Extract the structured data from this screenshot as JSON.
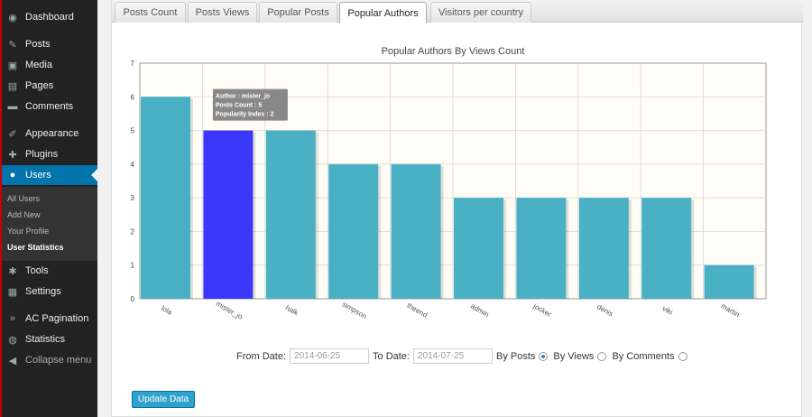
{
  "sidebar": {
    "items": [
      {
        "label": "Dashboard",
        "icon": "dashboard-icon"
      },
      {
        "label": "Posts",
        "icon": "pin-icon"
      },
      {
        "label": "Media",
        "icon": "media-icon"
      },
      {
        "label": "Pages",
        "icon": "pages-icon"
      },
      {
        "label": "Comments",
        "icon": "comment-icon"
      },
      {
        "label": "Appearance",
        "icon": "brush-icon"
      },
      {
        "label": "Plugins",
        "icon": "plugin-icon"
      },
      {
        "label": "Users",
        "icon": "user-icon"
      },
      {
        "label": "Tools",
        "icon": "wrench-icon"
      },
      {
        "label": "Settings",
        "icon": "settings-icon"
      },
      {
        "label": "AC Pagination",
        "icon": "chevrons-icon"
      },
      {
        "label": "Statistics",
        "icon": "globe-icon"
      },
      {
        "label": "Collapse menu",
        "icon": "collapse-icon"
      }
    ],
    "submenu": [
      "All Users",
      "Add New",
      "Your Profile",
      "User Statistics"
    ],
    "colors": {
      "background": "#222222",
      "active": "#0073aa"
    }
  },
  "tabs": [
    "Posts Count",
    "Posts Views",
    "Popular Posts",
    "Popular Authors",
    "Visitors per country"
  ],
  "chart_data": {
    "type": "bar",
    "title": "Popular Authors By Views Count",
    "categories": [
      "lola",
      "mister_jo",
      "halk",
      "simpson",
      "theend",
      "admin",
      "jocker",
      "denis",
      "viki",
      "martin"
    ],
    "values": [
      6,
      5,
      5,
      4,
      4,
      3,
      3,
      3,
      3,
      1
    ],
    "ylim": [
      0,
      7
    ],
    "yticks": [
      "0",
      "1",
      "2",
      "3",
      "4",
      "5",
      "6",
      "7"
    ],
    "grid": true,
    "colors": {
      "bar": "#4ab0c4",
      "highlight": "#3a37fb",
      "plot_bg": "#fffdf5"
    },
    "highlight_index": 1,
    "tooltip": [
      "Author : mister_jo",
      "Posts Count : 5",
      "Popularity Index : 2"
    ]
  },
  "filters": {
    "from_label": "From Date:",
    "from_value": "2014-06-25",
    "to_label": "To Date:",
    "to_value": "2014-07-25",
    "options": [
      "By Posts",
      "By Views",
      "By Comments"
    ],
    "selected": "By Posts"
  },
  "update_button": "Update Data"
}
